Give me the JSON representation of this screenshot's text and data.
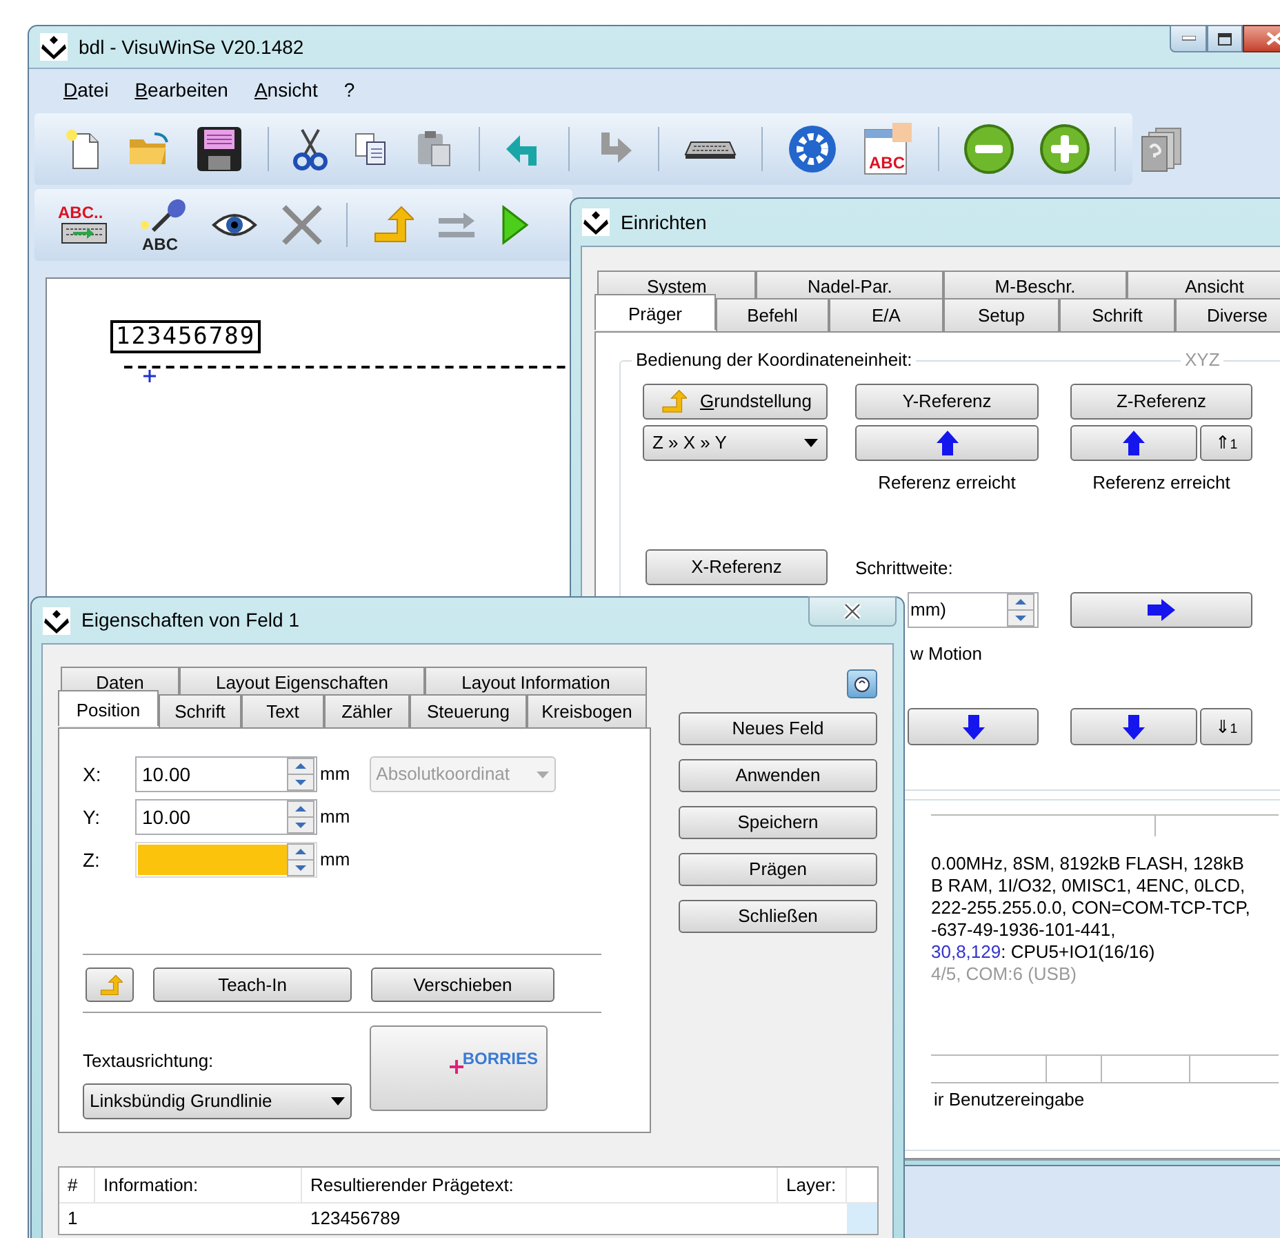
{
  "main_window": {
    "title": "bdl - VisuWinSe V20.1482",
    "menu": [
      "Datei",
      "Bearbeiten",
      "Ansicht",
      "?"
    ],
    "toolbar_labels": {
      "abc_document": "ABC",
      "text_keyboard": "ABC..",
      "voice": "ABC"
    },
    "canvas": {
      "field_text": "123456789"
    }
  },
  "setup_dialog": {
    "title": "Einrichten",
    "tab_rows": [
      [
        {
          "label": "System",
          "selected": false
        },
        {
          "label": "Nadel-Par.",
          "selected": false
        },
        {
          "label": "M-Beschr.",
          "selected": false
        },
        {
          "label": "Ansicht",
          "selected": false
        }
      ],
      [
        {
          "label": "Präger",
          "selected": true
        },
        {
          "label": "Befehl",
          "selected": false
        },
        {
          "label": "E/A",
          "selected": false
        },
        {
          "label": "Setup",
          "selected": false
        },
        {
          "label": "Schrift",
          "selected": false
        },
        {
          "label": "Diverse",
          "selected": false
        }
      ]
    ],
    "group_title": "Bedienung der Koordinateneinheit:",
    "group_tag": "XYZ",
    "home_button": "Grundstellung",
    "order_select": "Z » X » Y",
    "y_button": "Y-Referenz",
    "z_button": "Z-Referenz",
    "z_up_step": "⇑$_{1}$",
    "y_status": "Referenz erreicht",
    "z_status": "Referenz erreicht",
    "x_button": "X-Referenz",
    "step_label": "Schrittweite:",
    "step_value": "mm)",
    "motion_label": "w Motion",
    "z_down_step": "⇓$_{1}$",
    "info_lines": [
      {
        "kind": "plain",
        "text": "0.00MHz, 8SM, 8192kB FLASH, 128kB"
      },
      {
        "kind": "plain",
        "text": "B RAM, 1I/O32, 0MISC1, 4ENC, 0LCD,"
      },
      {
        "kind": "plain",
        "text": "222-255.255.0.0, CON=COM-TCP-TCP,"
      },
      {
        "kind": "plain",
        "text": "-637-49-1936-101-441,"
      },
      {
        "kind": "address",
        "address": "30,8,129",
        "text": ": CPU5+IO1(16/16)"
      },
      {
        "kind": "muted",
        "text": "4/5, COM:6 (USB)"
      }
    ],
    "footer_text": "ir Benutzereingabe"
  },
  "properties_dialog": {
    "title": "Eigenschaften von Feld 1",
    "tab_rows": [
      [
        {
          "label": "Daten",
          "selected": false
        },
        {
          "label": "Layout Eigenschaften",
          "selected": false
        },
        {
          "label": "Layout Information",
          "selected": false
        }
      ],
      [
        {
          "label": "Position",
          "selected": true
        },
        {
          "label": "Schrift",
          "selected": false
        },
        {
          "label": "Text",
          "selected": false
        },
        {
          "label": "Zähler",
          "selected": false
        },
        {
          "label": "Steuerung",
          "selected": false
        },
        {
          "label": "Kreisbogen",
          "selected": false
        }
      ]
    ],
    "coordinates": [
      {
        "label": "X:",
        "value": "10.00",
        "unit": "mm",
        "highlighted": false
      },
      {
        "label": "Y:",
        "value": "10.00",
        "unit": "mm",
        "highlighted": false
      },
      {
        "label": "Z:",
        "unit": "mm",
        "highlighted": true
      }
    ],
    "mode_select": {
      "value": "Absolutkoordinat",
      "disabled": true
    },
    "teach_button": "Teach-In",
    "move_button": "Verschieben",
    "align_label": "Textausrichtung:",
    "align_select": "Linksbündig Grundlinie",
    "preview_text": "BORRIES",
    "side_buttons": [
      "Neues Feld",
      "Anwenden",
      "Speichern",
      "Prägen",
      "Schließen"
    ],
    "table": {
      "columns": [
        "#",
        "Information:",
        "Resultierender Prägetext:",
        "Layer:"
      ],
      "rows": [
        [
          "1",
          "",
          "123456789",
          ""
        ]
      ]
    }
  }
}
